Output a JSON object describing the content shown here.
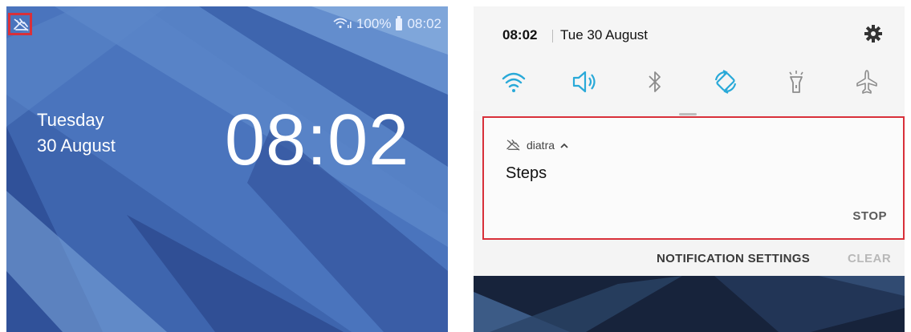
{
  "lock_screen": {
    "status": {
      "battery": "100%",
      "time": "08:02"
    },
    "date": {
      "weekday": "Tuesday",
      "day_month": "30 August"
    },
    "clock": "08:02"
  },
  "shade": {
    "time": "08:02",
    "date": "Tue 30 August",
    "quick_settings": [
      "wifi-icon",
      "sound-icon",
      "bluetooth-icon",
      "auto-rotate-icon",
      "flashlight-icon",
      "airplane-mode-icon"
    ],
    "notification": {
      "app_name": "diatra",
      "title": "Steps",
      "action": "STOP"
    },
    "footer": {
      "settings": "NOTIFICATION SETTINGS",
      "clear": "CLEAR"
    }
  },
  "colors": {
    "accent": "#29a9d8",
    "highlight": "#d8303a",
    "wallpaper": "#3d64ad"
  }
}
